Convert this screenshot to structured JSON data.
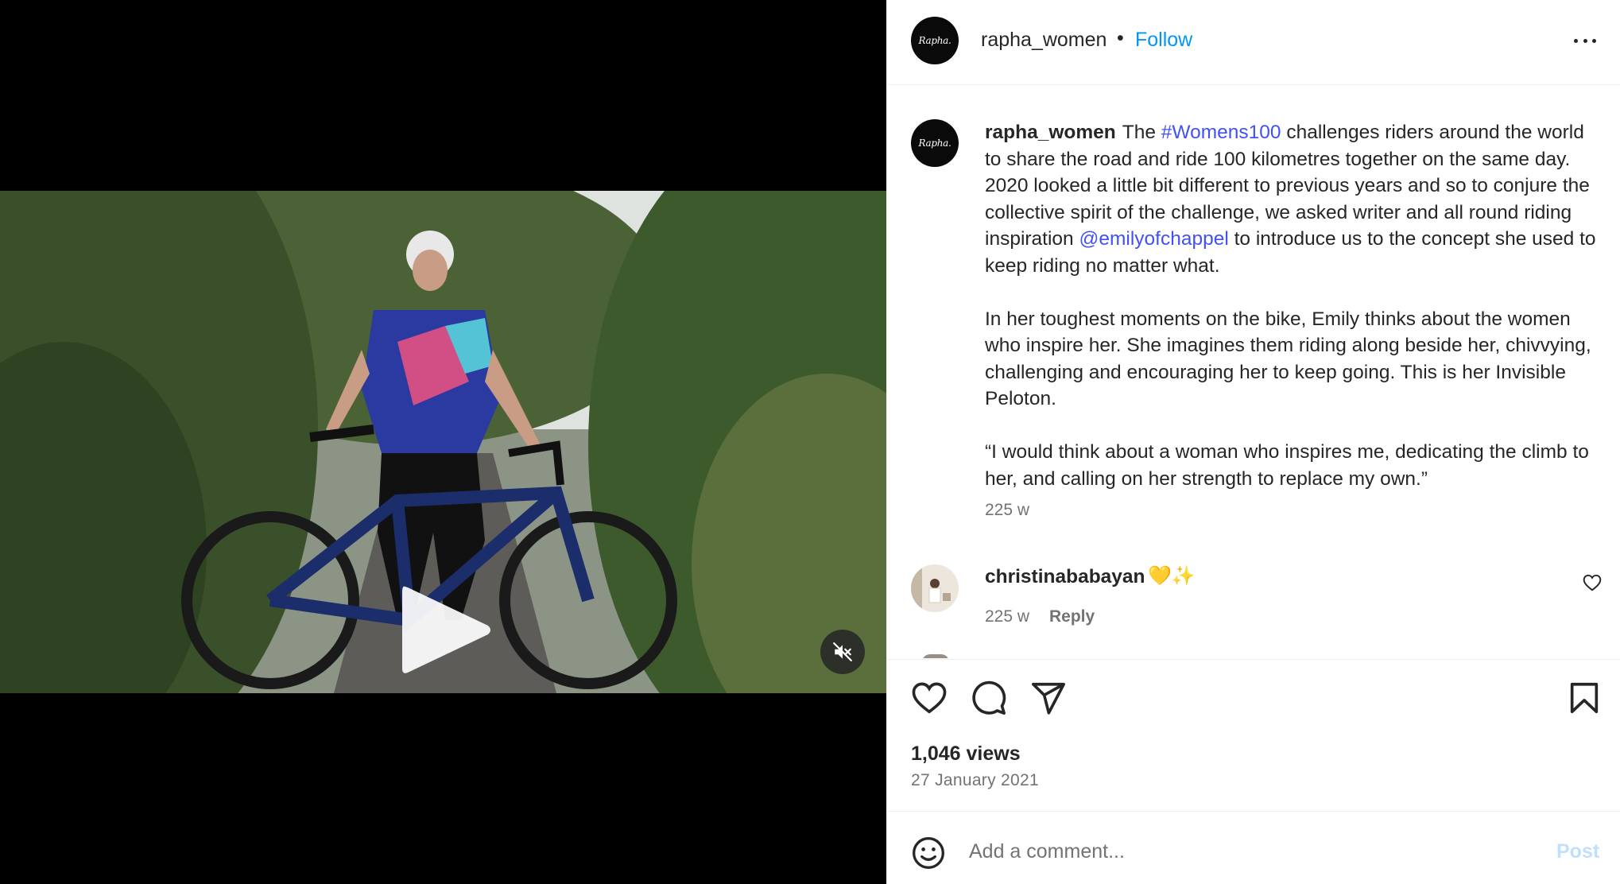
{
  "post": {
    "username": "rapha_women",
    "follow_label": "Follow",
    "separator": "•",
    "avatar_text": "Rapha."
  },
  "caption": {
    "username": "rapha_women",
    "p1_a": "The ",
    "hashtag": "#Womens100",
    "p1_b": " challenges riders around the world to share the road and ride 100 kilometres together on the same day. 2020 looked a little bit different to previous years and so to conjure the collective spirit of the challenge, we asked writer and all round riding inspiration ",
    "mention": "@emilyofchappel",
    "p1_c": " to introduce us to the concept she used to keep riding no matter what.",
    "p2": "In her toughest moments on the bike, Emily thinks about the women who inspire her. She imagines them riding along beside her, chivvying, challenging and encouraging her to keep going. This is her Invisible Peloton.",
    "p3": "“I would think about a woman who inspires me, dedicating the climb to her, and calling on her strength to replace my own.”",
    "time": "225 w"
  },
  "comments": [
    {
      "username": "christinababayan",
      "text": "💛✨",
      "time": "225 w",
      "reply_label": "Reply"
    }
  ],
  "stats": {
    "views": "1,046 views",
    "date": "27 January 2021"
  },
  "composer": {
    "placeholder": "Add a comment...",
    "post_label": "Post"
  },
  "icons": [
    "heart-icon",
    "comment-icon",
    "share-icon",
    "bookmark-icon",
    "emoji-icon",
    "more-icon",
    "play-icon",
    "mute-icon"
  ],
  "colors": {
    "link": "#4150f7",
    "follow": "#0095f6",
    "post_disabled": "#c0dffd"
  }
}
